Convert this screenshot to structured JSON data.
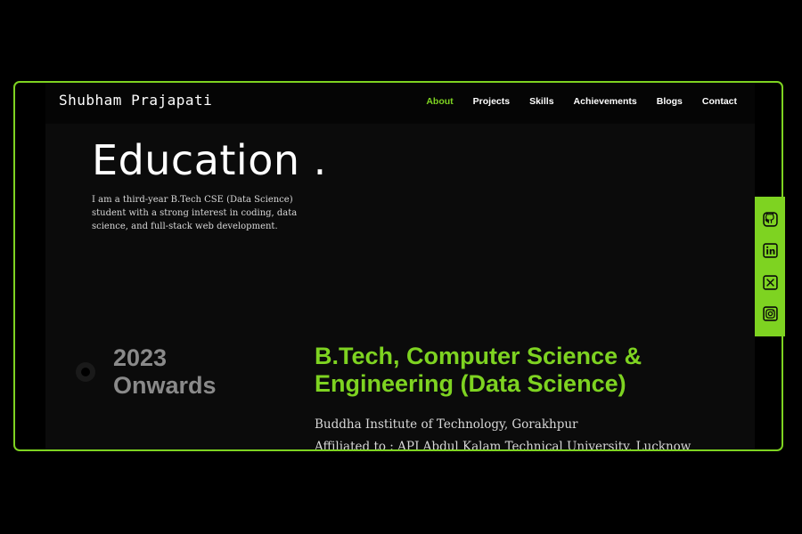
{
  "header": {
    "brand": "Shubham Prajapati",
    "nav": [
      "About",
      "Projects",
      "Skills",
      "Achievements",
      "Blogs",
      "Contact"
    ],
    "active_nav": "About"
  },
  "section": {
    "title": "Education .",
    "intro": "I am a third-year B.Tech CSE (Data Science) student with a strong interest in coding, data science, and full-stack web development."
  },
  "education": {
    "year_line1": "2023",
    "year_line2": "Onwards",
    "degree_line1": "B.Tech, Computer Science &",
    "degree_line2": "Engineering (Data Science)",
    "institute": "Buddha Institute of Technology, Gorakhpur",
    "affiliation": "Affiliated to : APJ Abdul Kalam Technical University, Lucknow"
  },
  "social": {
    "icons": [
      "github-icon",
      "linkedin-icon",
      "x-icon",
      "instagram-icon"
    ]
  },
  "colors": {
    "accent": "#7ed321",
    "background": "#0b0b0b",
    "year_text": "#8a8a8a"
  }
}
